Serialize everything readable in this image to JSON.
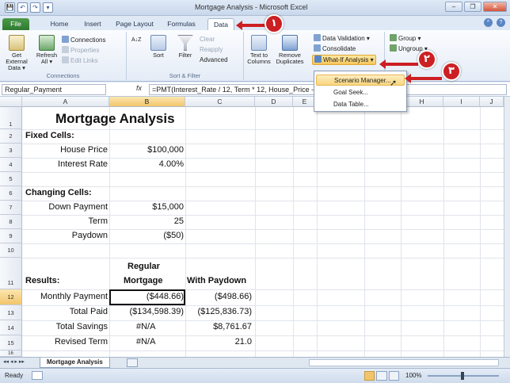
{
  "window": {
    "title": "Mortgage Analysis - Microsoft Excel",
    "controls": [
      "–",
      "❐",
      "✕"
    ]
  },
  "qat": [
    "💾",
    "↶",
    "↷",
    "▾"
  ],
  "tabs": [
    "File",
    "Home",
    "Insert",
    "Page Layout",
    "Formulas",
    "Data"
  ],
  "active_tab": "Data",
  "ribbon": {
    "connections": {
      "label": "Connections",
      "get_external": "Get External Data ▾",
      "refresh": "Refresh All ▾",
      "connections_btn": "Connections",
      "properties": "Properties",
      "edit_links": "Edit Links"
    },
    "sort_filter": {
      "label": "Sort & Filter",
      "az": "A↓Z",
      "sort": "Sort",
      "filter": "Filter",
      "clear": "Clear",
      "reapply": "Reapply",
      "advanced": "Advanced"
    },
    "data_tools": {
      "label": "Data Tools",
      "text_to_columns": "Text to Columns",
      "remove_dupes": "Remove Duplicates",
      "data_validation": "Data Validation ▾",
      "consolidate": "Consolidate",
      "whatif": "What-If Analysis ▾"
    },
    "outline": {
      "group": "Group ▾",
      "ungroup": "Ungroup ▾"
    }
  },
  "whatif_menu": [
    "Scenario Manager...",
    "Goal Seek...",
    "Data Table..."
  ],
  "formula_bar": {
    "name_box": "Regular_Payment",
    "fx": "fx",
    "formula": "=PMT(Interest_Rate / 12, Term * 12, House_Price - Down_Payment)"
  },
  "columns": [
    "A",
    "B",
    "C",
    "D",
    "E",
    "F",
    "G",
    "H",
    "I",
    "J"
  ],
  "rows": [
    "1",
    "2",
    "3",
    "4",
    "5",
    "6",
    "7",
    "8",
    "9",
    "10",
    "11",
    "12",
    "13",
    "14",
    "15",
    "16"
  ],
  "cells": {
    "title": "Mortgage Analysis",
    "fixed_cells": "Fixed Cells:",
    "house_price_label": "House Price",
    "house_price": "$100,000",
    "interest_rate_label": "Interest Rate",
    "interest_rate": "4.00%",
    "changing_cells": "Changing Cells:",
    "down_payment_label": "Down Payment",
    "down_payment": "$15,000",
    "term_label": "Term",
    "term": "25",
    "paydown_label": "Paydown",
    "paydown": "($50)",
    "regular_header_1": "Regular",
    "regular_header_2": "Mortgage",
    "paydown_header": "With Paydown",
    "results": "Results:",
    "monthly_payment_label": "Monthly Payment",
    "monthly_payment_regular": "($448.66)",
    "monthly_payment_paydown": "($498.66)",
    "total_paid_label": "Total Paid",
    "total_paid_regular": "($134,598.39)",
    "total_paid_paydown": "($125,836.73)",
    "total_savings_label": "Total Savings",
    "total_savings_regular": "#N/A",
    "total_savings_paydown": "$8,761.67",
    "revised_term_label": "Revised Term",
    "revised_term_regular": "#N/A",
    "revised_term_paydown": "21.0"
  },
  "sheet_tab": "Mortgage Analysis",
  "status": {
    "ready": "Ready",
    "zoom": "100%"
  },
  "markers": [
    "١",
    "٢",
    "٣"
  ],
  "colors": {
    "marker": "#cc1f24",
    "selection": "#f3c56b",
    "file_tab": "#2e7a31"
  }
}
